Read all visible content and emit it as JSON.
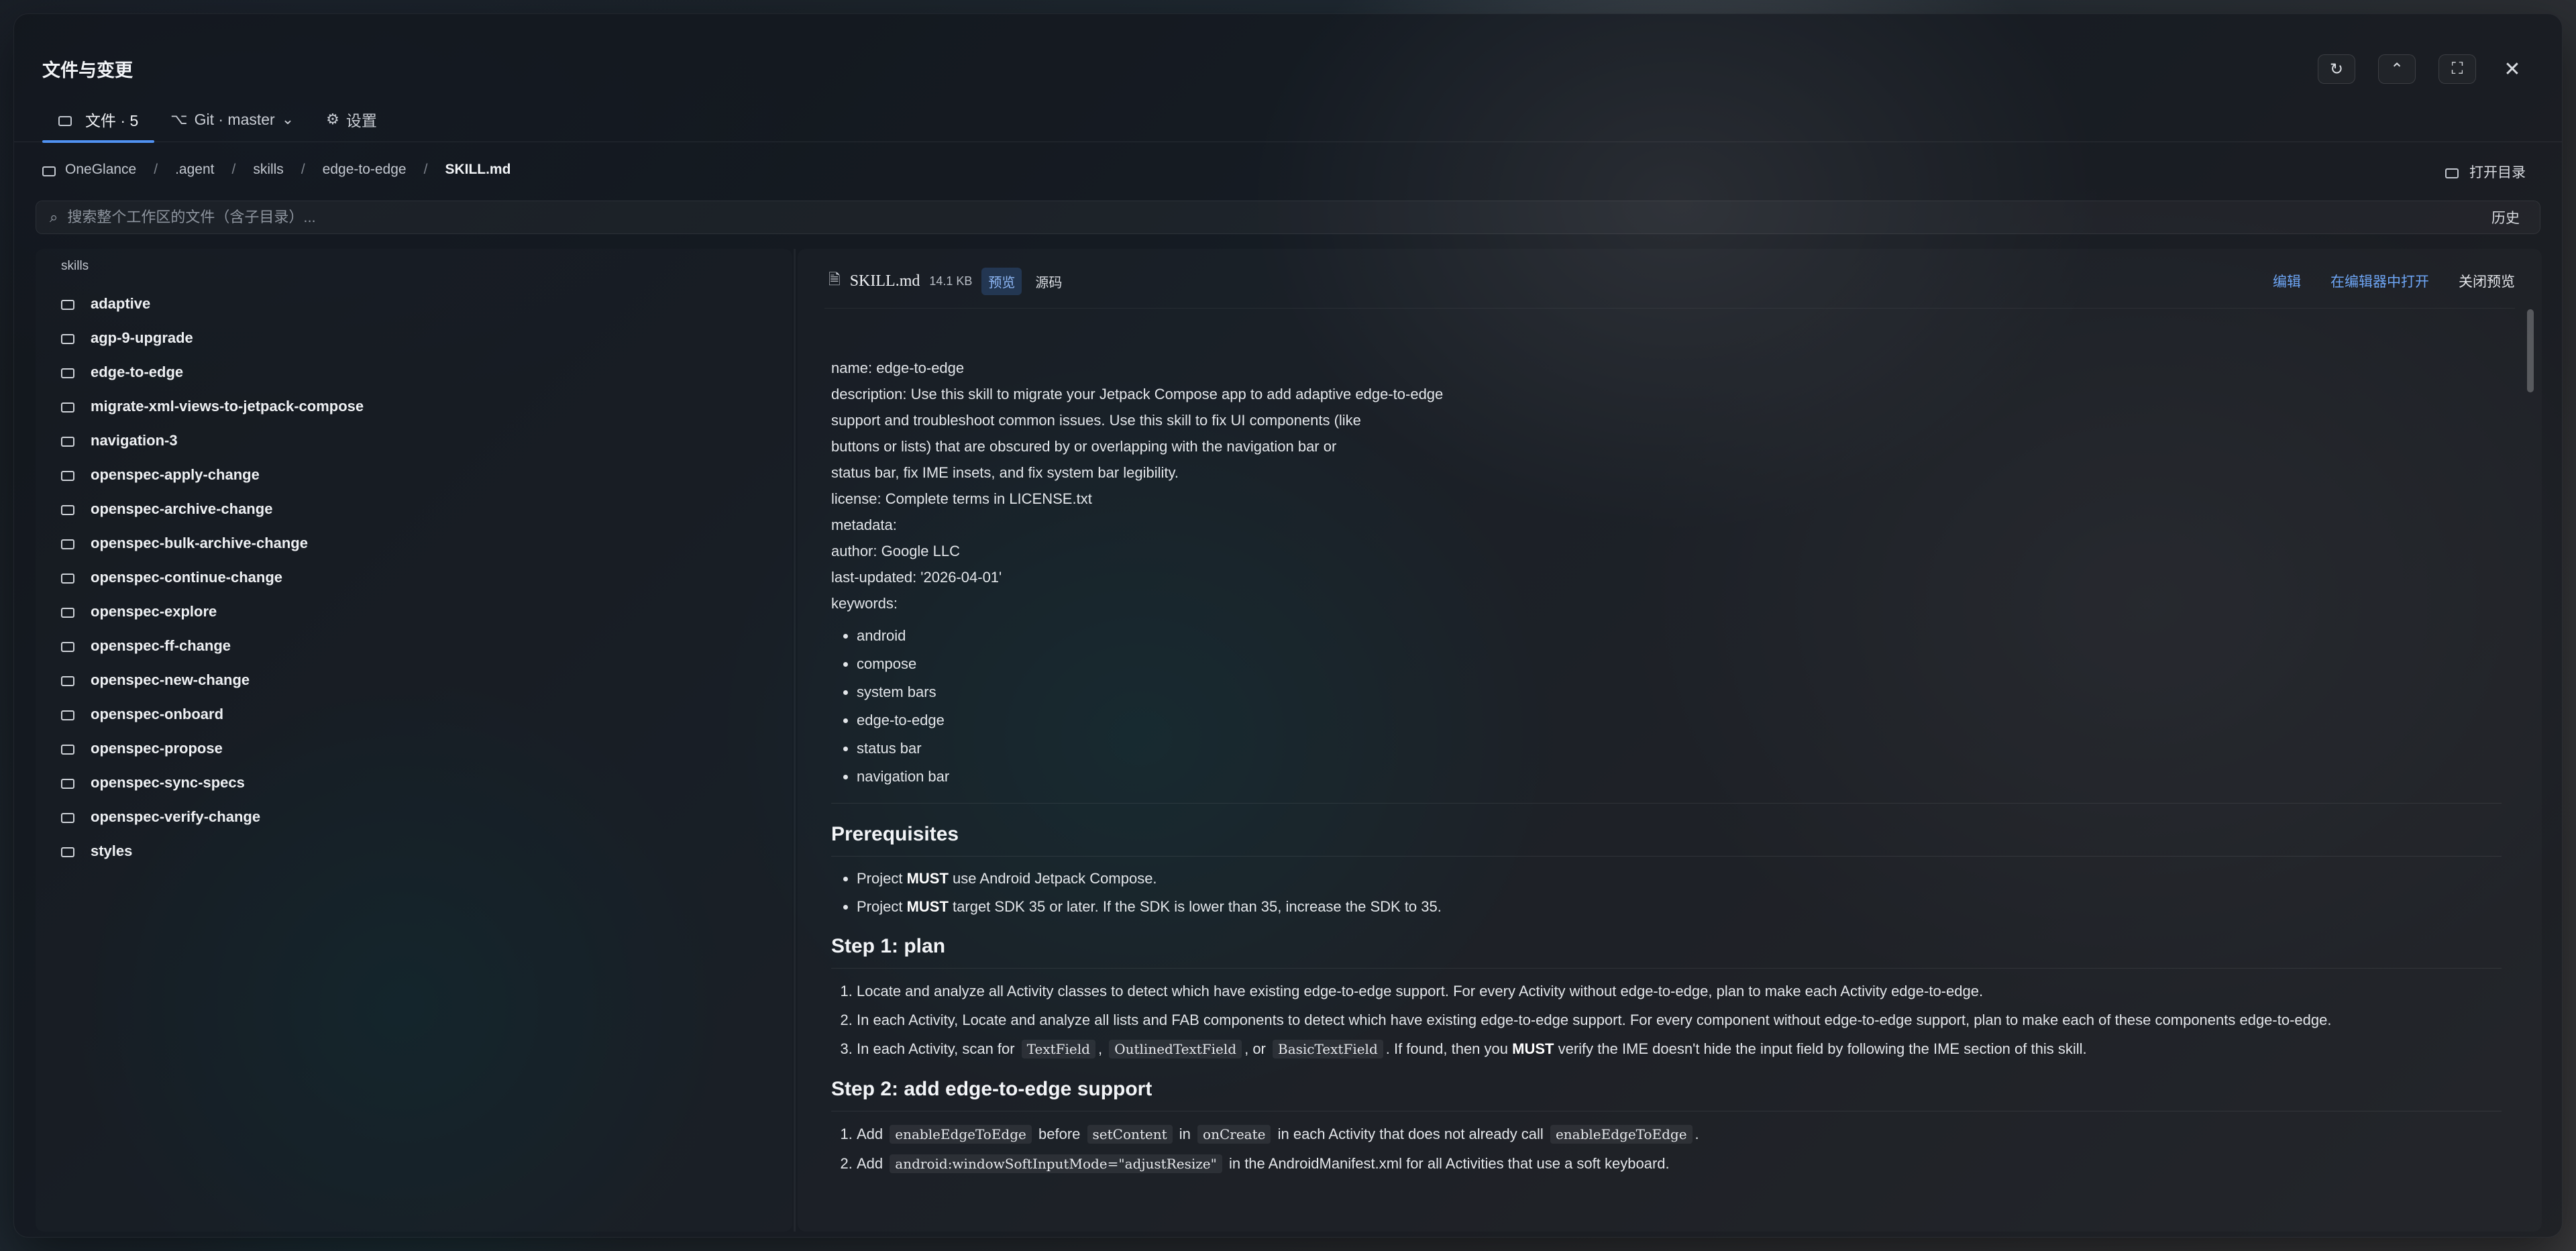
{
  "window": {
    "title": "文件与变更"
  },
  "tabs": [
    {
      "label": "文件 · 5"
    },
    {
      "label": "Git · master"
    },
    {
      "label": "设置"
    }
  ],
  "breadcrumb": [
    "OneGlance",
    ".agent",
    "skills",
    "edge-to-edge",
    "SKILL.md"
  ],
  "open_dir_label": "打开目录",
  "search": {
    "placeholder": "搜索整个工作区的文件（含子目录）...",
    "history_label": "历史"
  },
  "sidebar": {
    "label": "skills",
    "items": [
      "adaptive",
      "agp-9-upgrade",
      "edge-to-edge",
      "migrate-xml-views-to-jetpack-compose",
      "navigation-3",
      "openspec-apply-change",
      "openspec-archive-change",
      "openspec-bulk-archive-change",
      "openspec-continue-change",
      "openspec-explore",
      "openspec-ff-change",
      "openspec-new-change",
      "openspec-onboard",
      "openspec-propose",
      "openspec-sync-specs",
      "openspec-verify-change",
      "styles"
    ]
  },
  "preview": {
    "file_name": "SKILL.md",
    "file_size": "14.1 KB",
    "mode_preview": "预览",
    "mode_source": "源码",
    "action_edit": "编辑",
    "action_open_in_editor": "在编辑器中打开",
    "action_close_preview": "关闭预览"
  },
  "doc": {
    "frontmatter": [
      "name: edge-to-edge",
      "description: Use this skill to migrate your Jetpack Compose app to add adaptive edge-to-edge",
      "support and troubleshoot common issues. Use this skill to fix UI components (like",
      "buttons or lists) that are obscured by or overlapping with the navigation bar or",
      "status bar, fix IME insets, and fix system bar legibility.",
      "license: Complete terms in LICENSE.txt",
      "metadata:",
      "author: Google LLC",
      "last-updated: '2026-04-01'",
      "keywords:"
    ],
    "keywords": [
      "android",
      "compose",
      "system bars",
      "edge-to-edge",
      "status bar",
      "navigation bar"
    ],
    "prereq_title": "Prerequisites",
    "prereq": [
      {
        "pre": "Project ",
        "bold": "MUST",
        "post": " use Android Jetpack Compose."
      },
      {
        "pre": "Project ",
        "bold": "MUST",
        "post": " target SDK 35 or later. If the SDK is lower than 35, increase the SDK to 35."
      }
    ],
    "step1_title": "Step 1: plan",
    "step1": {
      "item1": "Locate and analyze all Activity classes to detect which have existing edge-to-edge support. For every Activity without edge-to-edge, plan to make each Activity edge-to-edge.",
      "item2": "In each Activity, Locate and analyze all lists and FAB components to detect which have existing edge-to-edge support. For every component without edge-to-edge support, plan to make each of these components edge-to-edge.",
      "item3_a": "In each Activity, scan for",
      "item3_code1": "TextField",
      "item3_b": ",",
      "item3_code2": "OutlinedTextField",
      "item3_c": ", or",
      "item3_code3": "BasicTextField",
      "item3_d": ". If found, then you",
      "item3_bold": "MUST",
      "item3_e": "verify the IME doesn't hide the input field by following the IME section of this skill."
    },
    "step2_title": "Step 2: add edge-to-edge support",
    "step2": {
      "item1_a": "Add",
      "item1_code1": "enableEdgeToEdge",
      "item1_b": "before",
      "item1_code2": "setContent",
      "item1_c": "in",
      "item1_code3": "onCreate",
      "item1_d": "in each Activity that does not already call",
      "item1_code4": "enableEdgeToEdge",
      "item1_e": ".",
      "item2_a": "Add",
      "item2_code1": "android:windowSoftInputMode=\"adjustResize\"",
      "item2_b": "in the AndroidManifest.xml for all Activities that use a soft keyboard."
    }
  }
}
